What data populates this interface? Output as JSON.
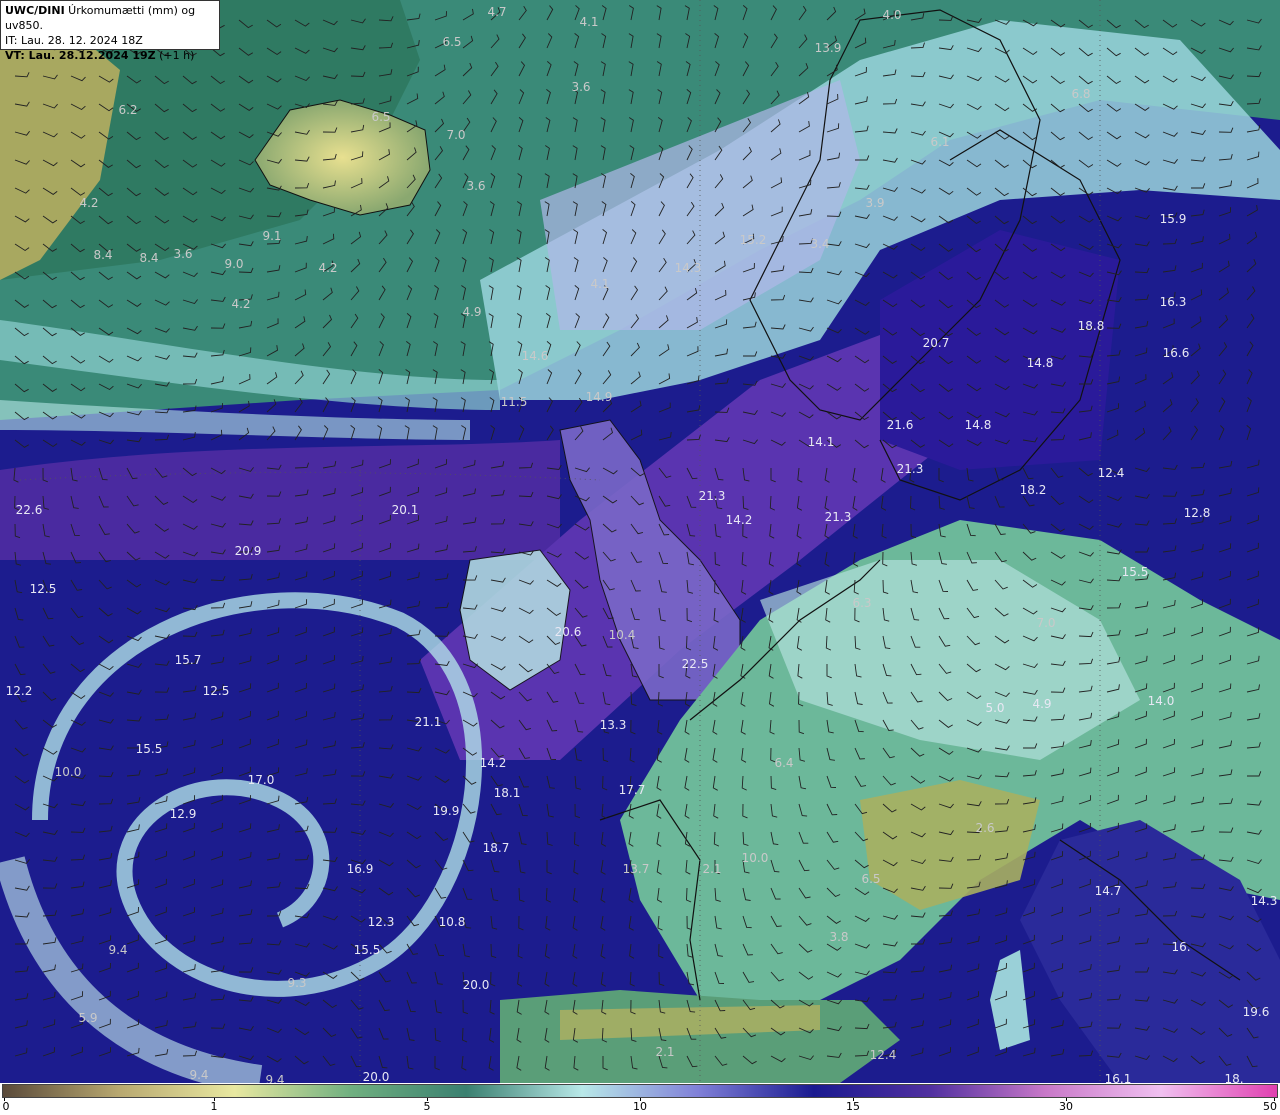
{
  "header": {
    "model": "UWC/DINI",
    "product": " Úrkomumætti (mm) og uv850.",
    "it_line": "IT: Lau. 28. 12. 2024 18Z",
    "vt_line_bold": "VT: Lau. 28.12.2024 19Z",
    "vt_line_suffix": " (+1 h)"
  },
  "colorbar": {
    "ticks": [
      "0",
      "1",
      "5",
      "10",
      "15",
      "30",
      "50"
    ],
    "colors": [
      "#5a4a3a",
      "#b8a870",
      "#e8e8a0",
      "#70b080",
      "#3a8070",
      "#b8e8e8",
      "#8080d8",
      "#1a1a90",
      "#5030a0",
      "#c878c8",
      "#f0c0f0",
      "#e040b0"
    ]
  },
  "map_labels": [
    {
      "text": "4.7",
      "tone": "light"
    },
    {
      "text": "4.1",
      "tone": "light"
    },
    {
      "text": "6.5",
      "tone": "light"
    },
    {
      "text": "4.0",
      "tone": "light"
    },
    {
      "text": "13.9",
      "tone": "light"
    },
    {
      "text": "3.6",
      "tone": "light"
    },
    {
      "text": "6.2",
      "tone": "light"
    },
    {
      "text": "6.5",
      "tone": "light"
    },
    {
      "text": "7.0",
      "tone": "light"
    },
    {
      "text": "6.8",
      "tone": "light"
    },
    {
      "text": "6.1",
      "tone": "light"
    },
    {
      "text": "3.6",
      "tone": "light"
    },
    {
      "text": "4.2",
      "tone": "light"
    },
    {
      "text": "3.9",
      "tone": "light"
    },
    {
      "text": "9.1",
      "tone": "light"
    },
    {
      "text": "15.2",
      "tone": "light"
    },
    {
      "text": "3.4",
      "tone": "light"
    },
    {
      "text": "15.9",
      "tone": "dark"
    },
    {
      "text": "8.4",
      "tone": "light"
    },
    {
      "text": "8.4",
      "tone": "light"
    },
    {
      "text": "3.6",
      "tone": "light"
    },
    {
      "text": "9.0",
      "tone": "light"
    },
    {
      "text": "4.2",
      "tone": "light"
    },
    {
      "text": "14.3",
      "tone": "light"
    },
    {
      "text": "4.1",
      "tone": "light"
    },
    {
      "text": "4.2",
      "tone": "light"
    },
    {
      "text": "4.9",
      "tone": "light"
    },
    {
      "text": "16.3",
      "tone": "dark"
    },
    {
      "text": "18.8",
      "tone": "dark"
    },
    {
      "text": "20.7",
      "tone": "dark"
    },
    {
      "text": "16.6",
      "tone": "dark"
    },
    {
      "text": "14.6",
      "tone": "light"
    },
    {
      "text": "14.8",
      "tone": "dark"
    },
    {
      "text": "11.5",
      "tone": "light"
    },
    {
      "text": "14.9",
      "tone": "light"
    },
    {
      "text": "21.6",
      "tone": "dark"
    },
    {
      "text": "14.8",
      "tone": "dark"
    },
    {
      "text": "14.1",
      "tone": "dark"
    },
    {
      "text": "21.3",
      "tone": "dark"
    },
    {
      "text": "12.4",
      "tone": "dark"
    },
    {
      "text": "21.3",
      "tone": "dark"
    },
    {
      "text": "18.2",
      "tone": "dark"
    },
    {
      "text": "22.6",
      "tone": "dark"
    },
    {
      "text": "20.1",
      "tone": "dark"
    },
    {
      "text": "14.2",
      "tone": "dark"
    },
    {
      "text": "21.3",
      "tone": "dark"
    },
    {
      "text": "12.8",
      "tone": "dark"
    },
    {
      "text": "20.9",
      "tone": "dark"
    },
    {
      "text": "15.5",
      "tone": "dark"
    },
    {
      "text": "12.5",
      "tone": "dark"
    },
    {
      "text": "6.3",
      "tone": "light"
    },
    {
      "text": "20.6",
      "tone": "dark"
    },
    {
      "text": "10.4",
      "tone": "light"
    },
    {
      "text": "7.0",
      "tone": "light"
    },
    {
      "text": "15.7",
      "tone": "dark"
    },
    {
      "text": "22.5",
      "tone": "dark"
    },
    {
      "text": "12.2",
      "tone": "dark"
    },
    {
      "text": "12.5",
      "tone": "dark"
    },
    {
      "text": "5.0",
      "tone": "dark"
    },
    {
      "text": "4.9",
      "tone": "dark"
    },
    {
      "text": "14.0",
      "tone": "dark"
    },
    {
      "text": "21.1",
      "tone": "dark"
    },
    {
      "text": "13.3",
      "tone": "dark"
    },
    {
      "text": "15.5",
      "tone": "dark"
    },
    {
      "text": "14.2",
      "tone": "dark"
    },
    {
      "text": "6.4",
      "tone": "light"
    },
    {
      "text": "10.0",
      "tone": "light"
    },
    {
      "text": "17.0",
      "tone": "dark"
    },
    {
      "text": "18.1",
      "tone": "dark"
    },
    {
      "text": "17.7",
      "tone": "dark"
    },
    {
      "text": "12.9",
      "tone": "dark"
    },
    {
      "text": "19.9",
      "tone": "dark"
    },
    {
      "text": "2.6",
      "tone": "light"
    },
    {
      "text": "18.7",
      "tone": "dark"
    },
    {
      "text": "10.0",
      "tone": "light"
    },
    {
      "text": "16.9",
      "tone": "dark"
    },
    {
      "text": "13.7",
      "tone": "light"
    },
    {
      "text": "2.1",
      "tone": "light"
    },
    {
      "text": "6.5",
      "tone": "light"
    },
    {
      "text": "14.7",
      "tone": "dark"
    },
    {
      "text": "14.3",
      "tone": "dark"
    },
    {
      "text": "12.3",
      "tone": "dark"
    },
    {
      "text": "10.8",
      "tone": "dark"
    },
    {
      "text": "3.8",
      "tone": "light"
    },
    {
      "text": "15.5",
      "tone": "dark"
    },
    {
      "text": "16.",
      "tone": "dark"
    },
    {
      "text": "9.4",
      "tone": "light"
    },
    {
      "text": "20.0",
      "tone": "dark"
    },
    {
      "text": "9.3",
      "tone": "light"
    },
    {
      "text": "19.6",
      "tone": "dark"
    },
    {
      "text": "5.9",
      "tone": "light"
    },
    {
      "text": "2.1",
      "tone": "light"
    },
    {
      "text": "12.4",
      "tone": "light"
    },
    {
      "text": "9.4",
      "tone": "light"
    },
    {
      "text": "9.4",
      "tone": "light"
    },
    {
      "text": "20.0",
      "tone": "dark"
    },
    {
      "text": "16.1",
      "tone": "dark"
    },
    {
      "text": "18.",
      "tone": "dark"
    }
  ]
}
